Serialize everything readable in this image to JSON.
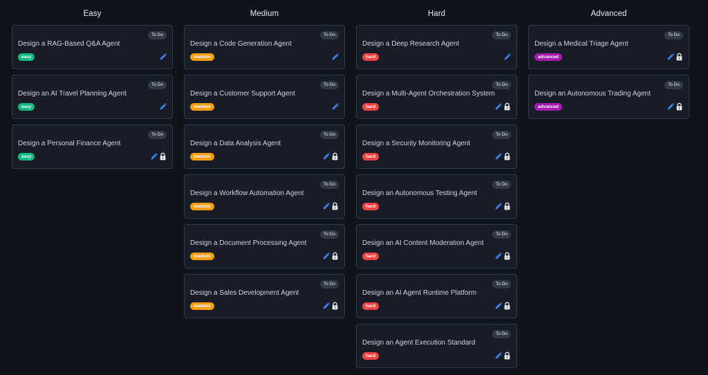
{
  "board": {
    "status_label": "To Do",
    "difficulty_colors": {
      "easy": "#10b981",
      "medium": "#f59e0b",
      "hard": "#ef4444",
      "advanced": "#a21caf"
    },
    "icon_colors": {
      "edit": "#3b82f6",
      "lock": "#e5e7eb"
    },
    "columns": [
      {
        "title": "Easy",
        "cards": [
          {
            "title": "Design a RAG-Based Q&A Agent",
            "status": "To Do",
            "difficulty": "easy",
            "locked": false
          },
          {
            "title": "Design an AI Travel Planning Agent",
            "status": "To Do",
            "difficulty": "easy",
            "locked": false
          },
          {
            "title": "Design a Personal Finance Agent",
            "status": "To Do",
            "difficulty": "easy",
            "locked": true
          }
        ]
      },
      {
        "title": "Medium",
        "cards": [
          {
            "title": "Design a Code Generation Agent",
            "status": "To Do",
            "difficulty": "medium",
            "locked": false
          },
          {
            "title": "Design a Customer Support Agent",
            "status": "To Do",
            "difficulty": "medium",
            "locked": false
          },
          {
            "title": "Design a Data Analysis Agent",
            "status": "To Do",
            "difficulty": "medium",
            "locked": true
          },
          {
            "title": "Design a Workflow Automation Agent",
            "status": "To Do",
            "difficulty": "medium",
            "locked": true
          },
          {
            "title": "Design a Document Processing Agent",
            "status": "To Do",
            "difficulty": "medium",
            "locked": true
          },
          {
            "title": "Design a Sales Development Agent",
            "status": "To Do",
            "difficulty": "medium",
            "locked": true
          }
        ]
      },
      {
        "title": "Hard",
        "cards": [
          {
            "title": "Design a Deep Research Agent",
            "status": "To Do",
            "difficulty": "hard",
            "locked": false
          },
          {
            "title": "Design a Multi-Agent Orchestration System",
            "status": "To Do",
            "difficulty": "hard",
            "locked": true
          },
          {
            "title": "Design a Security Monitoring Agent",
            "status": "To Do",
            "difficulty": "hard",
            "locked": true
          },
          {
            "title": "Design an Autonomous Testing Agent",
            "status": "To Do",
            "difficulty": "hard",
            "locked": true
          },
          {
            "title": "Design an AI Content Moderation Agent",
            "status": "To Do",
            "difficulty": "hard",
            "locked": true
          },
          {
            "title": "Design an AI Agent Runtime Platform",
            "status": "To Do",
            "difficulty": "hard",
            "locked": true
          },
          {
            "title": "Design an Agent Execution Standard",
            "status": "To Do",
            "difficulty": "hard",
            "locked": true
          }
        ]
      },
      {
        "title": "Advanced",
        "cards": [
          {
            "title": "Design a Medical Triage Agent",
            "status": "To Do",
            "difficulty": "advanced",
            "locked": true
          },
          {
            "title": "Design an Autonomous Trading Agent",
            "status": "To Do",
            "difficulty": "advanced",
            "locked": true
          }
        ]
      }
    ]
  }
}
